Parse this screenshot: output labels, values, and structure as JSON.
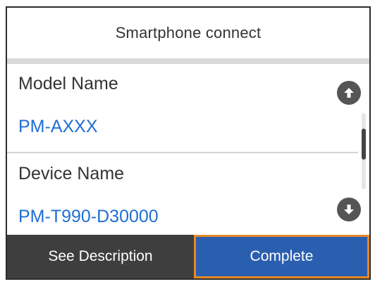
{
  "title": "Smartphone connect",
  "rows": [
    {
      "label": "Model Name",
      "value": "PM-AXXX"
    },
    {
      "label": "Device Name",
      "value": "PM-T990-D30000"
    }
  ],
  "icons": {
    "scroll_up": "arrow-up-circle-icon",
    "scroll_down": "arrow-down-circle-icon"
  },
  "buttons": {
    "see_description": "See Description",
    "complete": "Complete"
  },
  "colors": {
    "value_text": "#1f6fd1",
    "complete_button": "#2a5fb0",
    "focus_border": "#e58a2a",
    "bottom_bar": "#454545"
  }
}
